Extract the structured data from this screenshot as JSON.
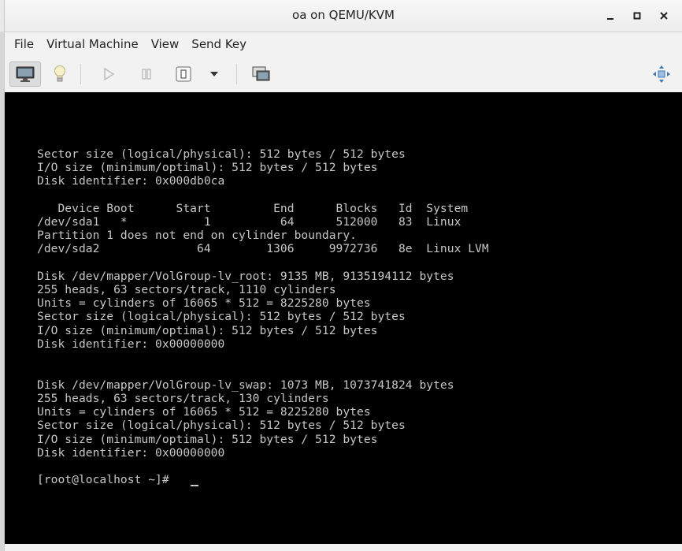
{
  "window": {
    "title": "oa on QEMU/KVM"
  },
  "menu": [
    "File",
    "Virtual Machine",
    "View",
    "Send Key"
  ],
  "toolbar": {
    "icons": [
      "monitor-icon",
      "lightbulb-icon",
      "play-icon",
      "pause-icon",
      "power-icon",
      "dropdown-arrow-icon",
      "snapshot-icon",
      "fullscreen-icon"
    ]
  },
  "console": {
    "lines": [
      "Sector size (logical/physical): 512 bytes / 512 bytes",
      "I/O size (minimum/optimal): 512 bytes / 512 bytes",
      "Disk identifier: 0x000db0ca",
      "",
      "   Device Boot      Start         End      Blocks   Id  System",
      "/dev/sda1   *           1          64      512000   83  Linux",
      "Partition 1 does not end on cylinder boundary.",
      "/dev/sda2              64        1306     9972736   8e  Linux LVM",
      "",
      "Disk /dev/mapper/VolGroup-lv_root: 9135 MB, 9135194112 bytes",
      "255 heads, 63 sectors/track, 1110 cylinders",
      "Units = cylinders of 16065 * 512 = 8225280 bytes",
      "Sector size (logical/physical): 512 bytes / 512 bytes",
      "I/O size (minimum/optimal): 512 bytes / 512 bytes",
      "Disk identifier: 0x00000000",
      "",
      "",
      "Disk /dev/mapper/VolGroup-lv_swap: 1073 MB, 1073741824 bytes",
      "255 heads, 63 sectors/track, 130 cylinders",
      "Units = cylinders of 16065 * 512 = 8225280 bytes",
      "Sector size (logical/physical): 512 bytes / 512 bytes",
      "I/O size (minimum/optimal): 512 bytes / 512 bytes",
      "Disk identifier: 0x00000000",
      "",
      "[root@localhost ~]# "
    ]
  }
}
